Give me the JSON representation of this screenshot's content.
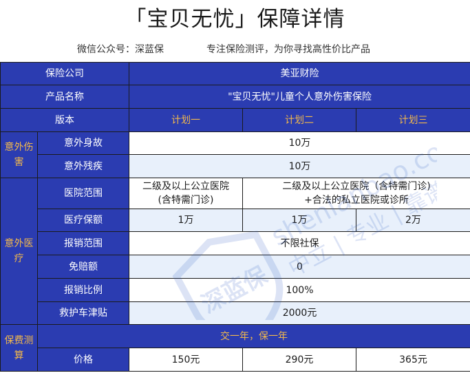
{
  "header": {
    "title": "「宝贝无忧」保障详情",
    "subtitle_left": "微信公众号：深蓝保",
    "subtitle_right": "专注保险测评，为你寻找高性价比产品"
  },
  "table": {
    "company_label": "保险公司",
    "company_value": "美亚财险",
    "product_label": "产品名称",
    "product_value": "\"宝贝无忧\"儿童个人意外伤害保险",
    "version_label": "版本",
    "plans": [
      "计划一",
      "计划二",
      "计划三"
    ],
    "cat_accident": "意外伤害",
    "death_label": "意外身故",
    "death_value": "10万",
    "disability_label": "意外残疾",
    "disability_value": "10万",
    "cat_medical": "意外医疗",
    "hospital_label": "医院范围",
    "hospital_plan1_line1": "二级及以上公立医院",
    "hospital_plan1_line2": "(含特需门诊)",
    "hospital_plan23_line1": "二级及以上公立医院（含特需门诊)",
    "hospital_plan23_line2": "+合法的私立医院或诊所",
    "medical_amount_label": "医疗保额",
    "medical_amounts": [
      "1万",
      "1万",
      "2万"
    ],
    "reimburse_scope_label": "报销范围",
    "reimburse_scope_value": "不限社保",
    "deductible_label": "免赔额",
    "deductible_value": "0",
    "reimburse_ratio_label": "报销比例",
    "reimburse_ratio_value": "100%",
    "ambulance_label": "救护车津贴",
    "ambulance_value": "2000元",
    "cat_premium": "保费测算",
    "term_value": "交一年，保一年",
    "price_label": "价格",
    "prices": [
      "150元",
      "290元",
      "365元"
    ]
  },
  "watermark": {
    "logo_text": "深蓝保",
    "domain_text": "shenlanbao.com",
    "slogan_text": "中立 | 专业 | 靠谱"
  }
}
